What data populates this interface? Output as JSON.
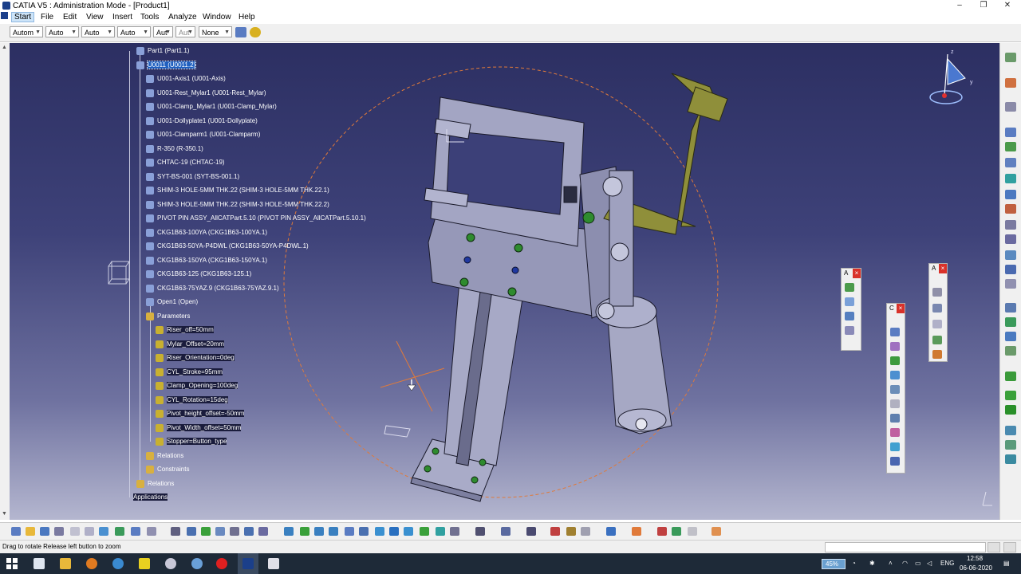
{
  "window": {
    "title": "CATIA V5 : Administration Mode - [Product1]",
    "controls": [
      "–",
      "❐",
      "✕"
    ]
  },
  "menu": [
    "Start",
    "File",
    "Edit",
    "View",
    "Insert",
    "Tools",
    "Analyze",
    "Window",
    "Help"
  ],
  "toolbar": {
    "combos": [
      "Autom",
      "Auto",
      "Auto",
      "Auto",
      "Aut",
      "Aut",
      "None"
    ]
  },
  "tree": {
    "items": [
      {
        "label": "Part1 (Part1.1)",
        "indent": 0,
        "kind": "part"
      },
      {
        "label": "U0011 (U0011.2)",
        "indent": 0,
        "kind": "product",
        "selected": true
      },
      {
        "label": "U001-Axis1 (U001-Axis)",
        "indent": 1,
        "kind": "part"
      },
      {
        "label": "U001-Rest_Mylar1 (U001-Rest_Mylar)",
        "indent": 1,
        "kind": "part"
      },
      {
        "label": "U001-Clamp_Mylar1 (U001-Clamp_Mylar)",
        "indent": 1,
        "kind": "part"
      },
      {
        "label": "U001-Dollyplate1 (U001-Dollyplate)",
        "indent": 1,
        "kind": "part"
      },
      {
        "label": "U001-Clamparm1 (U001-Clamparm)",
        "indent": 1,
        "kind": "part"
      },
      {
        "label": "R-350 (R-350.1)",
        "indent": 1,
        "kind": "part"
      },
      {
        "label": "CHTAC-19 (CHTAC-19)",
        "indent": 1,
        "kind": "part"
      },
      {
        "label": "SYT-BS-001 (SYT-BS-001.1)",
        "indent": 1,
        "kind": "part"
      },
      {
        "label": "SHIM-3 HOLE-5MM THK.22 (SHIM-3 HOLE-5MM THK.22.1)",
        "indent": 1,
        "kind": "part"
      },
      {
        "label": "SHIM-3 HOLE-5MM THK.22 (SHIM-3 HOLE-5MM THK.22.2)",
        "indent": 1,
        "kind": "part"
      },
      {
        "label": "PIVOT PIN ASSY_AllCATPart.5.10 (PIVOT PIN ASSY_AllCATPart.5.10.1)",
        "indent": 1,
        "kind": "part"
      },
      {
        "label": "CKG1B63-100YA (CKG1B63-100YA.1)",
        "indent": 1,
        "kind": "part"
      },
      {
        "label": "CKG1B63-50YA-P4DWL (CKG1B63-50YA-P4DWL.1)",
        "indent": 1,
        "kind": "part"
      },
      {
        "label": "CKG1B63-150YA (CKG1B63-150YA.1)",
        "indent": 1,
        "kind": "part"
      },
      {
        "label": "CKG1B63-125 (CKG1B63-125.1)",
        "indent": 1,
        "kind": "part"
      },
      {
        "label": "CKG1B63-75YAZ.9 (CKG1B63-75YAZ.9.1)",
        "indent": 1,
        "kind": "part"
      },
      {
        "label": "Open1 (Open)",
        "indent": 1,
        "kind": "part"
      },
      {
        "label": "Parameters",
        "indent": 1,
        "kind": "folder"
      },
      {
        "label": "Riser_off=50mm",
        "indent": 2,
        "kind": "param"
      },
      {
        "label": "Mylar_Offset=20mm",
        "indent": 2,
        "kind": "param"
      },
      {
        "label": "Riser_Orientation=0deg",
        "indent": 2,
        "kind": "param"
      },
      {
        "label": "CYL_Stroke=95mm",
        "indent": 2,
        "kind": "param"
      },
      {
        "label": "Clamp_Opening=100deg",
        "indent": 2,
        "kind": "param"
      },
      {
        "label": "CYL_Rotation=15deg",
        "indent": 2,
        "kind": "param"
      },
      {
        "label": "Pivot_height_offset=-50mm",
        "indent": 2,
        "kind": "param"
      },
      {
        "label": "Pivot_Width_offset=50mm",
        "indent": 2,
        "kind": "param"
      },
      {
        "label": "Stopper=Button_type",
        "indent": 2,
        "kind": "param"
      },
      {
        "label": "Relations",
        "indent": 1,
        "kind": "folder"
      },
      {
        "label": "Constraints",
        "indent": 1,
        "kind": "folder"
      },
      {
        "label": "Relations",
        "indent": 0,
        "kind": "folder"
      },
      {
        "label": "Applications",
        "indent": -1,
        "kind": "root"
      }
    ]
  },
  "compass": {
    "axis_x": "x",
    "axis_y": "y",
    "axis_z": "z"
  },
  "palettes": {
    "a_label": "A",
    "b_label": "A",
    "c_label": "C"
  },
  "status": {
    "message": "Drag to rotate  Release left button to zoom"
  },
  "taskbar": {
    "battery": "45%",
    "language": "ENG",
    "time": "12:58",
    "date": "06-06-2020"
  },
  "colors": {
    "viewport_top": "#2c2f62",
    "viewport_bottom": "#b4b6cf",
    "selection": "#1f5fbf",
    "part_body": "#9a9cbf",
    "arm_highlight": "#9a9a3a",
    "manip_circle": "#e07a3a"
  }
}
